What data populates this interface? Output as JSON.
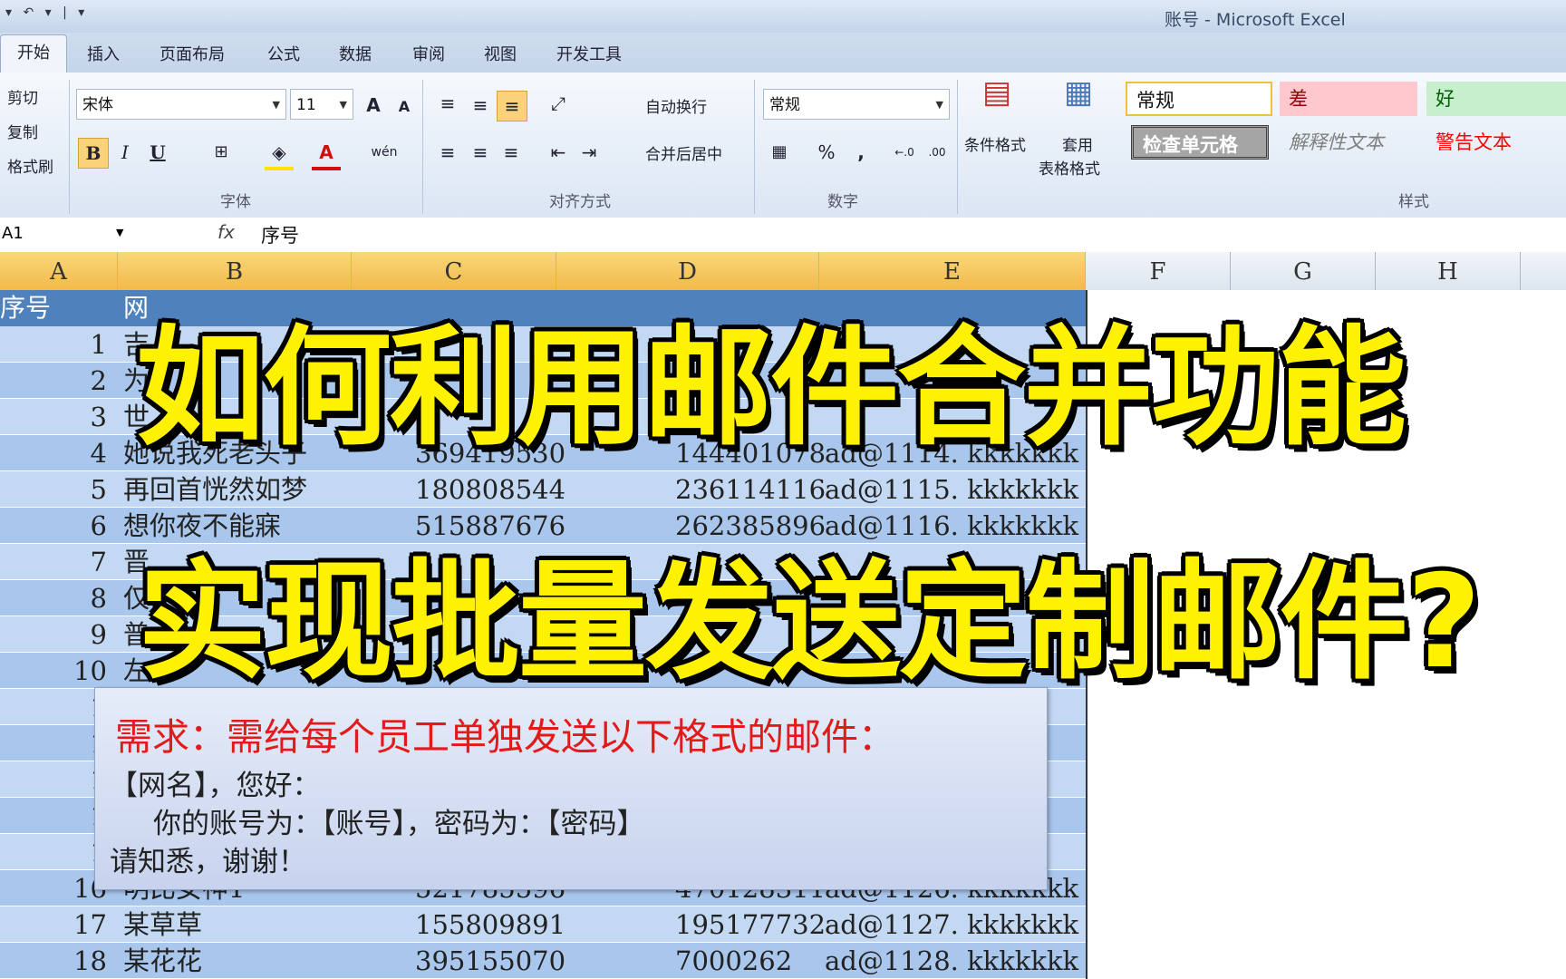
{
  "window": {
    "qat": "▾ ↶ ▾ | ▾",
    "title": "账号  -  Microsoft Excel"
  },
  "tabs": [
    "开始",
    "插入",
    "页面布局",
    "公式",
    "数据",
    "审阅",
    "视图",
    "开发工具"
  ],
  "ribbon": {
    "clipboard": {
      "cut": "剪切",
      "copy": "复制",
      "format_painter": "格式刷"
    },
    "font": {
      "name": "宋体",
      "size": "11",
      "label": "字体",
      "bold": "B",
      "italic": "I",
      "underline": "U",
      "grow": "A",
      "shrink": "A",
      "font_color": "A",
      "wen": "wén"
    },
    "alignment": {
      "wrap": "自动换行",
      "merge": "合并后居中",
      "label": "对齐方式"
    },
    "number": {
      "format": "常规",
      "percent": "%",
      "comma": ",",
      "label": "数字",
      "inc": "←.0",
      "dec": ".00"
    },
    "styles": {
      "cond_format": "条件格式",
      "table_format_1": "套用",
      "table_format_2": "表格格式",
      "normal": "常规",
      "bad": "差",
      "good": "好",
      "check_cell": "检查单元格",
      "explanatory": "解释性文本",
      "warning": "警告文本",
      "label": "样式"
    }
  },
  "formula_bar": {
    "name_box": "A1",
    "fx": "fx",
    "content": "序号"
  },
  "columns": [
    "A",
    "B",
    "C",
    "D",
    "E",
    "F",
    "G",
    "H"
  ],
  "table": {
    "header_a": "序号",
    "header_b": "网",
    "rows": [
      {
        "n": "1",
        "b": "吉",
        "c": "",
        "d": "",
        "e": ""
      },
      {
        "n": "2",
        "b": "为",
        "c": "",
        "d": "",
        "e": ""
      },
      {
        "n": "3",
        "b": "世",
        "c": "",
        "d": "",
        "e": ""
      },
      {
        "n": "4",
        "b": "她说我死老头子",
        "c": "369419530",
        "d": "144401078",
        "e": "ad@1114. kkkkkkk"
      },
      {
        "n": "5",
        "b": "再回首恍然如梦",
        "c": "180808544",
        "d": "236114116",
        "e": "ad@1115. kkkkkkk"
      },
      {
        "n": "6",
        "b": "想你夜不能寐",
        "c": "515887676",
        "d": "262385896",
        "e": "ad@1116. kkkkkkk"
      },
      {
        "n": "7",
        "b": "晋",
        "c": "",
        "d": "",
        "e": ""
      },
      {
        "n": "8",
        "b": "仅",
        "c": "",
        "d": "",
        "e": ""
      },
      {
        "n": "9",
        "b": "普",
        "c": "",
        "d": "",
        "e": ""
      },
      {
        "n": "10",
        "b": "左",
        "c": "",
        "d": "",
        "e": ""
      },
      {
        "n": "1",
        "b": "",
        "c": "",
        "d": "",
        "e": ""
      },
      {
        "n": "1",
        "b": "",
        "c": "",
        "d": "",
        "e": ""
      },
      {
        "n": "1",
        "b": "",
        "c": "",
        "d": "",
        "e": ""
      },
      {
        "n": "1",
        "b": "",
        "c": "",
        "d": "",
        "e": ""
      },
      {
        "n": "1",
        "b": "",
        "c": "",
        "d": "",
        "e": ""
      },
      {
        "n": "16",
        "b": "明比女神1",
        "c": "521785596",
        "d": "470128311",
        "e": "ad@1126. kkkkkkk"
      },
      {
        "n": "17",
        "b": "某草草",
        "c": "155809891",
        "d": "195177732",
        "e": "ad@1127. kkkkkkk"
      },
      {
        "n": "18",
        "b": "某花花",
        "c": "395155070",
        "d": "7000262",
        "e": "ad@1128. kkkkkkk"
      }
    ]
  },
  "overlay": {
    "title1": "如何利用邮件合并功能",
    "title2": "实现批量发送定制邮件?"
  },
  "note": {
    "title": "需求：需给每个员工单独发送以下格式的邮件：",
    "line1": "【网名】，您好：",
    "line2": "你的账号为：【账号】，密码为：【密码】",
    "line3": "请知悉，谢谢！"
  }
}
